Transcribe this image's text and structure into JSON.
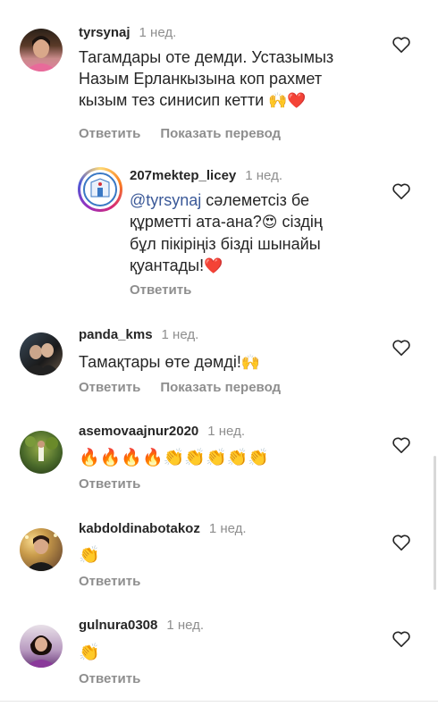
{
  "comments": [
    {
      "username": "tyrsynaj",
      "time": "1 нед.",
      "text": "Тагамдары оте демди. Устазымыз Назым Ерланкызына коп рахмет кызым тез синисип кетти",
      "emoji": "🙌❤️",
      "reply_label": "Ответить",
      "translate_label": "Показать перевод",
      "avatar_icon": "profile-photo-woman-pink-top"
    },
    {
      "username": "207mektep_licey",
      "time": "1 нед.",
      "mention": "@tyrsynaj",
      "text_line1": " сәлеметсіз бе",
      "text_line2": "құрметті ата-ана?",
      "text_emoji": "😍",
      "text_line2b": " сіздің",
      "text_line3": "бұл пікіріңіз бізді шынайы",
      "text_line4": "қуантады!",
      "emoji_end": "❤️",
      "reply_label": "Ответить",
      "avatar_icon": "school-logo-story-ring"
    },
    {
      "username": "panda_kms",
      "time": "1 нед.",
      "text": "Тамақтары өте дәмді!",
      "emoji": "🙌",
      "reply_label": "Ответить",
      "translate_label": "Показать перевод",
      "avatar_icon": "profile-photo-couple"
    },
    {
      "username": "asemovaajnur2020",
      "time": "1 нед.",
      "emoji": "🔥🔥🔥🔥👏👏👏👏👏",
      "reply_label": "Ответить",
      "avatar_icon": "profile-photo-garden"
    },
    {
      "username": "kabdoldinabotakoz",
      "time": "1 нед.",
      "emoji": "👏",
      "reply_label": "Ответить",
      "avatar_icon": "profile-photo-woman-lights"
    },
    {
      "username": "gulnura0308",
      "time": "1 нед.",
      "emoji": "👏",
      "reply_label": "Ответить",
      "avatar_icon": "profile-photo-woman-purple"
    }
  ],
  "colors": {
    "mention": "#3b5998",
    "muted": "#8e8e8e",
    "story_ring": "#e1306c"
  }
}
